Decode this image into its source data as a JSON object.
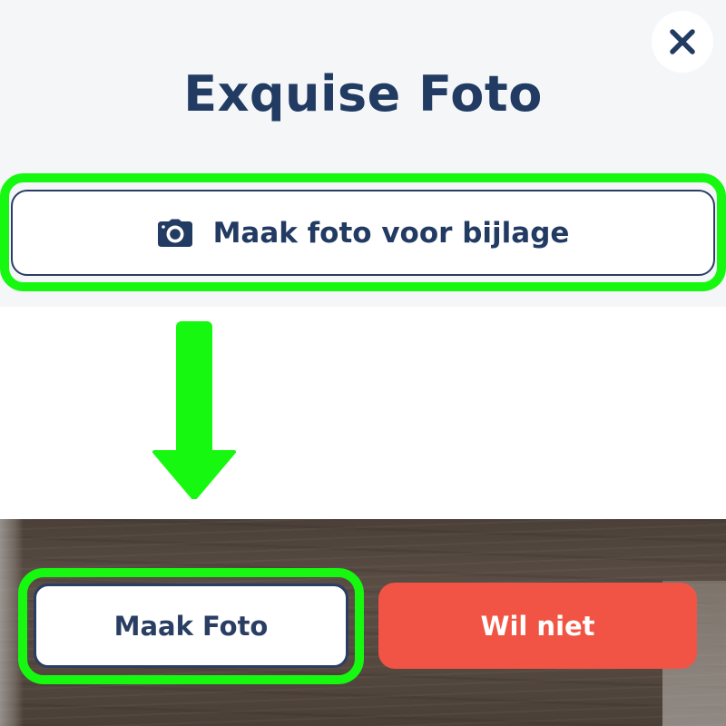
{
  "dialog": {
    "title": "Exquise Foto",
    "close_icon": "close-icon"
  },
  "attachment": {
    "button_label": "Maak foto voor bijlage",
    "icon": "camera-icon"
  },
  "annotation": {
    "highlight_color": "#16f80f",
    "arrow_icon": "arrow-down-icon"
  },
  "camera": {
    "take_photo_label": "Maak Foto",
    "decline_label": "Wil niet"
  },
  "colors": {
    "primary": "#223b62",
    "danger": "#f15444",
    "highlight": "#16f80f",
    "panel_background": "#f5f6f8"
  }
}
